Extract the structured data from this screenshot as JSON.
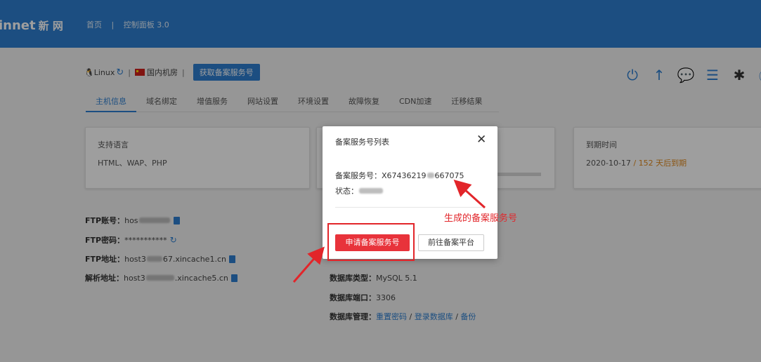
{
  "header": {
    "logo_text": "innet",
    "logo_cn": "新 网",
    "nav_home": "首页",
    "nav_sep": "|",
    "nav_panel": "控制面板 3.0"
  },
  "os_row": {
    "os": "Linux",
    "sep": "|",
    "datacenter": "国内机房",
    "get_record_button": "获取备案服务号"
  },
  "toolbar_icons": [
    "power-icon",
    "upload-icon",
    "chat-icon",
    "document-icon",
    "bug-icon",
    "info-icon"
  ],
  "tabs": [
    "主机信息",
    "域名绑定",
    "增值服务",
    "网站设置",
    "环境设置",
    "故障恢复",
    "CDN加速",
    "迁移结果"
  ],
  "cards": {
    "lang_title": "支持语言",
    "lang_value": "HTML、WAP、PHP",
    "expire_title": "到期时间",
    "expire_date": "2020-10-17",
    "expire_sep": "/",
    "expire_days": "152 天后到期"
  },
  "ftp": {
    "account_label": "FTP账号：",
    "account_value": "hos",
    "password_label": "FTP密码：",
    "password_value": "***********",
    "address_label": "FTP地址：",
    "address_value_a": "host3",
    "address_value_b": "67.xincache1.cn",
    "resolve_label": "解析地址：",
    "resolve_value_a": "host3",
    "resolve_value_b": ".xincache5.cn"
  },
  "db": {
    "type_label": "数据库类型：",
    "type_value": "MySQL 5.1",
    "port_label": "数据库端口：",
    "port_value": "3306",
    "manage_label": "数据库管理：",
    "reset": "重置密码",
    "sep1": " / ",
    "login": "登录数据库",
    "sep2": " / ",
    "backup": "备份"
  },
  "modal": {
    "title": "备案服务号列表",
    "close": "✕",
    "service_label": "备案服务号：",
    "service_prefix": "X67436219",
    "service_suffix": "667075",
    "status_label": "状态：",
    "apply_button": "申请备案服务号",
    "goto_button": "前往备案平台"
  },
  "annotation": {
    "text": "生成的备案服务号",
    "color": "#e2252a"
  }
}
